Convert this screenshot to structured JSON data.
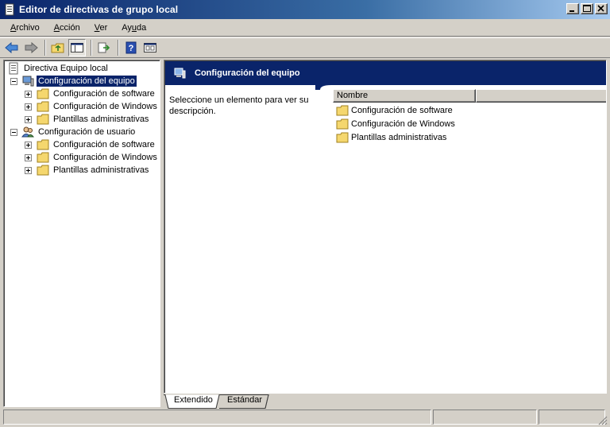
{
  "window": {
    "title": "Editor de directivas de grupo local"
  },
  "menu": {
    "items": [
      {
        "label_pre": "",
        "label_u": "A",
        "label_post": "rchivo"
      },
      {
        "label_pre": "",
        "label_u": "A",
        "label_post": "cción"
      },
      {
        "label_pre": "",
        "label_u": "V",
        "label_post": "er"
      },
      {
        "label_pre": "Ay",
        "label_u": "u",
        "label_post": "da"
      }
    ]
  },
  "toolbar": {
    "icons": [
      "back-arrow-icon",
      "forward-arrow-icon",
      "up-folder-icon",
      "show-hide-tree-icon",
      "export-list-icon",
      "help-icon",
      "properties-icon"
    ]
  },
  "tree": {
    "root": "Directiva Equipo local",
    "nodes": [
      {
        "label": "Configuración del equipo",
        "selected": true,
        "children": [
          "Configuración de software",
          "Configuración de Windows",
          "Plantillas administrativas"
        ]
      },
      {
        "label": "Configuración de usuario",
        "selected": false,
        "children": [
          "Configuración de software",
          "Configuración de Windows",
          "Plantillas administrativas"
        ]
      }
    ]
  },
  "right": {
    "header_title": "Configuración del equipo",
    "description": "Seleccione un elemento para ver su descripción.",
    "column_name": "Nombre",
    "items": [
      "Configuración de software",
      "Configuración de Windows",
      "Plantillas administrativas"
    ]
  },
  "tabs": {
    "extended": "Extendido",
    "standard": "Estándar"
  },
  "colors": {
    "title_start": "#0a246a",
    "title_end": "#a6caf0",
    "header_bg": "#0a246a",
    "chrome": "#d4d0c8",
    "folder": "#f5d76e"
  }
}
